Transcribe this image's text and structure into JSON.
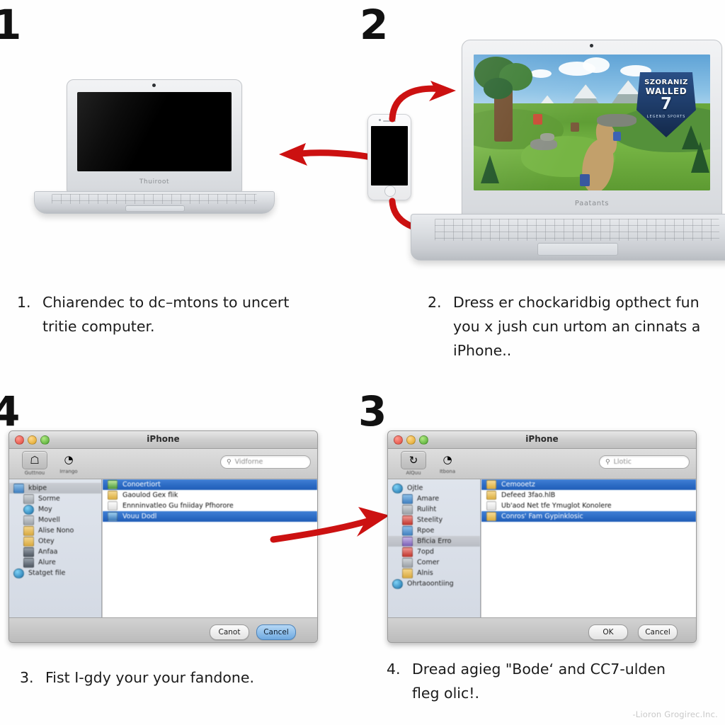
{
  "steps": {
    "one": {
      "numeral": "1",
      "index": "1.",
      "text": "Chiarendec to dc–mtons to uncert tritie computer."
    },
    "two": {
      "numeral": "2",
      "index": "2.",
      "text": "Dress er chockaridbig opthect fun you x jush cun urtom an cinnats a iPhone.."
    },
    "three": {
      "numeral": "4",
      "index": "3.",
      "text": "Fist I-gdy your your fandone."
    },
    "four": {
      "numeral": "3",
      "index": "4.",
      "text": "Dread agieg \"Bode‘ and CC7-ulden fleg olic!."
    }
  },
  "laptop_closed": {
    "brand": "Thuiroot"
  },
  "laptop_game": {
    "brand": "Paatants",
    "logo": {
      "line1": "SZORANIZ",
      "line2": "WALLED",
      "line3": "7",
      "line4": "LEGEND SPORTS"
    }
  },
  "window_left": {
    "title": "iPhone",
    "search_placeholder": "Vidforne",
    "toolbar": [
      {
        "label": "Guttnou",
        "icon": "home-icon",
        "glyph": "⌂",
        "selected": true
      },
      {
        "label": "Irrango",
        "icon": "media-icon",
        "glyph": "◔",
        "selected": false
      }
    ],
    "sidebar": [
      {
        "label": "kbipe",
        "icon": "folder-icon",
        "color": "blue",
        "indent": false,
        "selected": true
      },
      {
        "label": "Sorme",
        "icon": "device-icon",
        "color": "grey",
        "indent": true,
        "selected": false
      },
      {
        "label": "Moy",
        "icon": "compass-icon",
        "color": "globe",
        "indent": true,
        "selected": false
      },
      {
        "label": "Movell",
        "icon": "archive-icon",
        "color": "grey",
        "indent": true,
        "selected": false
      },
      {
        "label": "Alise Nono",
        "icon": "folder-icon",
        "color": "tan",
        "indent": true,
        "selected": false
      },
      {
        "label": "Otey",
        "icon": "folder-icon",
        "color": "tan",
        "indent": true,
        "selected": false
      },
      {
        "label": "Anfaa",
        "icon": "photos-icon",
        "color": "dark",
        "indent": true,
        "selected": false
      },
      {
        "label": "Alure",
        "icon": "movies-icon",
        "color": "dark",
        "indent": true,
        "selected": false
      },
      {
        "label": "Statget file",
        "icon": "network-icon",
        "color": "globe",
        "indent": false,
        "selected": false
      }
    ],
    "files": [
      {
        "label": "Conoertiort",
        "icon": "app-icon",
        "color": "g",
        "selected": true
      },
      {
        "label": "Gaoulod Gex flik",
        "icon": "folder-icon",
        "color": "y",
        "selected": false
      },
      {
        "label": "Ennninvatleo Gu fniiday Pfhorore",
        "icon": "doc-icon",
        "color": "w",
        "selected": false
      },
      {
        "label": "Vouu Dodl",
        "icon": "disk-icon",
        "color": "b",
        "selected": true
      }
    ],
    "buttons": [
      {
        "label": "Canot",
        "primary": false
      },
      {
        "label": "Cancel",
        "primary": true
      }
    ]
  },
  "window_right": {
    "title": "iPhone",
    "search_placeholder": "Llotic",
    "toolbar": [
      {
        "label": "AlQuu",
        "icon": "sync-icon",
        "glyph": "↻",
        "selected": true
      },
      {
        "label": "Itbona",
        "icon": "media-icon",
        "glyph": "◔",
        "selected": false
      }
    ],
    "sidebar": [
      {
        "label": "Ojtle",
        "icon": "help-icon",
        "color": "globe",
        "indent": false,
        "selected": false
      },
      {
        "label": "Amare",
        "icon": "book-icon",
        "color": "blue",
        "indent": true,
        "selected": false
      },
      {
        "label": "Ruliht",
        "icon": "photos-icon",
        "color": "grey",
        "indent": true,
        "selected": false
      },
      {
        "label": "Steelity",
        "icon": "music-icon",
        "color": "red",
        "indent": true,
        "selected": false
      },
      {
        "label": "Rpoe",
        "icon": "folder-icon",
        "color": "blue",
        "indent": true,
        "selected": false
      },
      {
        "label": "Bficia Erro",
        "icon": "disc-icon",
        "color": "purple",
        "indent": true,
        "selected": true
      },
      {
        "label": "7opd",
        "icon": "photo-icon",
        "color": "red",
        "indent": true,
        "selected": false
      },
      {
        "label": "Comer",
        "icon": "tv-icon",
        "color": "grey",
        "indent": true,
        "selected": false
      },
      {
        "label": "Alnis",
        "icon": "apps-icon",
        "color": "tan",
        "indent": true,
        "selected": false
      },
      {
        "label": "Ohrtaoontiing",
        "icon": "network-icon",
        "color": "globe",
        "indent": false,
        "selected": false
      }
    ],
    "files": [
      {
        "label": "Cemooetz",
        "icon": "folder-icon",
        "color": "y",
        "selected": true
      },
      {
        "label": "Defeed 3fao.hlB",
        "icon": "folder-icon",
        "color": "y",
        "selected": false
      },
      {
        "label": "Ub'aod Net tfe Ymuglot Konolere",
        "icon": "clock-icon",
        "color": "w",
        "selected": false
      },
      {
        "label": "Conros' Fam Gypinklosic",
        "icon": "app-icon",
        "color": "y",
        "selected": true
      }
    ],
    "buttons": [
      {
        "label": "OK",
        "primary": false
      },
      {
        "label": "Cancel",
        "primary": false
      }
    ]
  },
  "watermark": "-Lioron Grogirec.Inc.",
  "colors": {
    "arrow_red": "#CC1111",
    "selection_blue": "#2f6ec4",
    "primary_button": "#6fa9e0"
  }
}
